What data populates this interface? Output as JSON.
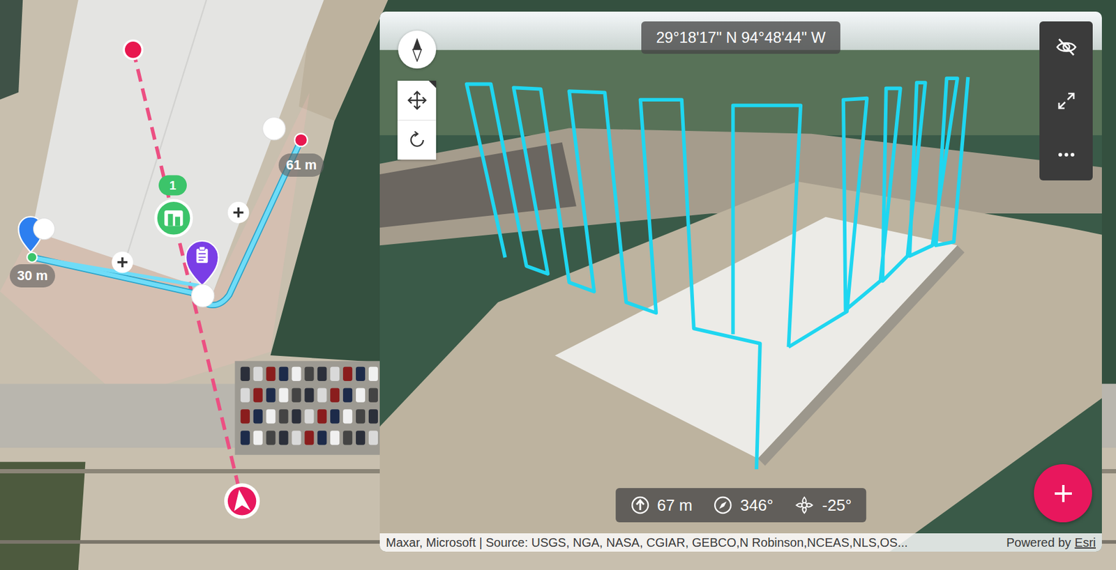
{
  "map": {
    "distance_labels": [
      {
        "text": "61 m"
      },
      {
        "text": "30 m"
      }
    ],
    "poi_badge": "1"
  },
  "view3d": {
    "coordinates": "29°18'17\" N 94°48'44\" W",
    "telemetry": [
      {
        "kind": "altitude",
        "value": "67 m"
      },
      {
        "kind": "heading",
        "value": "346°"
      },
      {
        "kind": "gimbal",
        "value": "-25°"
      }
    ],
    "attribution": "Maxar, Microsoft | Source: USGS, NGA, NASA, CGIAR, GEBCO,N Robinson,NCEAS,NLS,OS...",
    "powered_by": "Powered by",
    "powered_link": "Esri"
  }
}
